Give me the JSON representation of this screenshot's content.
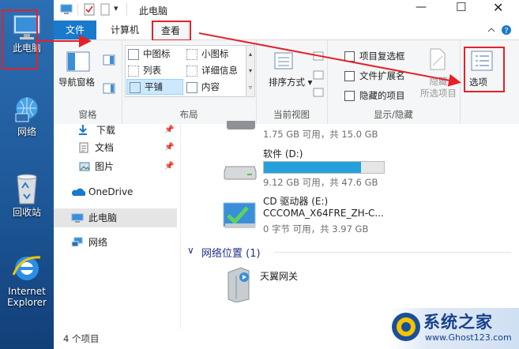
{
  "desktop": {
    "icons": [
      {
        "label": "此电脑",
        "icon": "computer-icon"
      },
      {
        "label": "网络",
        "icon": "network-icon"
      },
      {
        "label": "回收站",
        "icon": "recycle-bin-icon"
      },
      {
        "label": "Internet Explorer",
        "icon": "ie-icon"
      }
    ]
  },
  "window": {
    "title": "此电脑",
    "tabs": {
      "file": "文件",
      "computer": "计算机",
      "view": "查看"
    },
    "ribbon": {
      "pane": {
        "nav_pane": "导航窗格",
        "group": "窗格"
      },
      "layout": {
        "items": [
          "中图标",
          "小图标",
          "列表",
          "详细信息",
          "平铺",
          "内容"
        ],
        "group": "布局"
      },
      "current_view": {
        "sort_by": "排序方式",
        "group": "当前视图"
      },
      "show_hide": {
        "item_checkboxes": "项目复选框",
        "file_extensions": "文件扩展名",
        "hidden_items": "隐藏的项目",
        "hide": "隐藏",
        "hide_selected": "所选项目",
        "group": "显示/隐藏"
      },
      "options": "选项"
    },
    "nav": {
      "items": [
        "下载",
        "文档",
        "图片",
        "OneDrive",
        "此电脑",
        "网络"
      ]
    },
    "drives": [
      {
        "name": "",
        "free_text": "1.75 GB 可用，共 15.0 GB",
        "fill": 0.88
      },
      {
        "name": "软件 (D:)",
        "free_text": "9.12 GB 可用，共 47.6 GB",
        "fill": 0.81
      },
      {
        "name": "CD 驱动器 (E:)",
        "label2": "CCCOMA_X64FRE_ZH-C...",
        "free_text": "0 字节 可用，共 3.97 GB",
        "fill": 1.0
      }
    ],
    "network_section": {
      "title": "网络位置 (1)",
      "item": "天翼网关"
    },
    "status": "4 个项目"
  },
  "watermark": {
    "text": "系统之家",
    "url": "www.Ghost123.com"
  },
  "colors": {
    "accent": "#1979ca",
    "annotation": "#e32228",
    "bar_fill": "#26a0da"
  }
}
